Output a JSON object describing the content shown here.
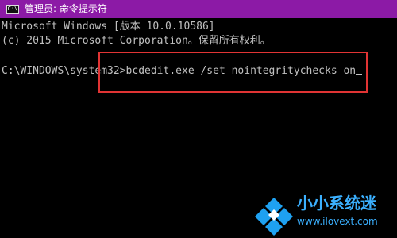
{
  "window": {
    "title": "管理员: 命令提示符",
    "icon": "cmd-icon"
  },
  "console": {
    "line1": "Microsoft Windows [版本 10.0.10586]",
    "line2": "(c) 2015 Microsoft Corporation。保留所有权利。",
    "prompt": "C:\\WINDOWS\\system32>",
    "command": "bcdedit.exe /set nointegritychecks on"
  },
  "watermark": {
    "title": "小小系统迷",
    "url": "www.ilovext.com"
  },
  "colors": {
    "titlebar": "#8c1aa6",
    "console_text": "#c0c0c0",
    "highlight": "#e13434",
    "watermark": "#3bb0ff"
  }
}
